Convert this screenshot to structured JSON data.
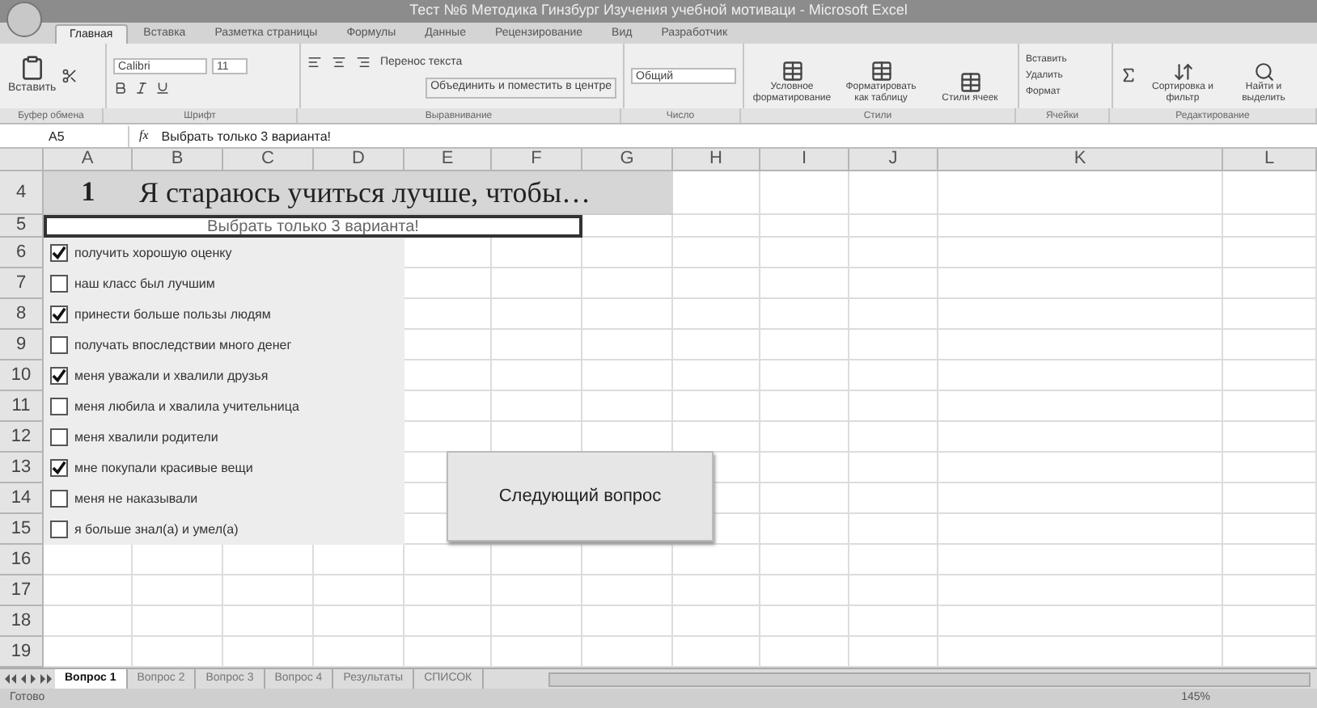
{
  "window": {
    "title": "Тест №6 Методика Гинзбург Изучения учебной мотиваци - Microsoft Excel"
  },
  "ribbon_tabs": [
    {
      "label": "Главная",
      "selected": true
    },
    {
      "label": "Вставка",
      "selected": false
    },
    {
      "label": "Разметка страницы",
      "selected": false
    },
    {
      "label": "Формулы",
      "selected": false
    },
    {
      "label": "Данные",
      "selected": false
    },
    {
      "label": "Рецензирование",
      "selected": false
    },
    {
      "label": "Вид",
      "selected": false
    },
    {
      "label": "Разработчик",
      "selected": false
    }
  ],
  "ribbon": {
    "paste": "Вставить",
    "font_name": "Calibri",
    "font_size": "11",
    "wrap_text": "Перенос текста",
    "merge": "Объединить и поместить в центре",
    "number_format": "Общий",
    "styles": [
      "Условное форматирование",
      "Форматировать как таблицу",
      "Стили ячеек"
    ],
    "cells": [
      "Вставить",
      "Удалить",
      "Формат"
    ],
    "editing": [
      "Сортировка и фильтр",
      "Найти и выделить"
    ]
  },
  "group_labels": [
    "Буфер обмена",
    "Шрифт",
    "Выравнивание",
    "Число",
    "Стили",
    "Ячейки",
    "Редактирование"
  ],
  "formula_bar": {
    "cell": "A5",
    "function_label": "fx",
    "formula": "Выбрать только 3 варианта!"
  },
  "columns": [
    "A",
    "B",
    "C",
    "D",
    "E",
    "F",
    "G",
    "H",
    "I",
    "J",
    "K",
    "L"
  ],
  "question": {
    "row": "4",
    "number": "1",
    "text": "Я стараюсь учиться лучше, чтобы…"
  },
  "instruction": {
    "row": "5",
    "text": "Выбрать только 3 варианта!"
  },
  "options": [
    {
      "row": "6",
      "label": "получить хорошую оценку",
      "checked": true
    },
    {
      "row": "7",
      "label": "наш класс был лучшим",
      "checked": false
    },
    {
      "row": "8",
      "label": "принести больше пользы людям",
      "checked": true
    },
    {
      "row": "9",
      "label": "получать впоследствии много денег",
      "checked": false
    },
    {
      "row": "10",
      "label": "меня уважали и хвалили друзья",
      "checked": true
    },
    {
      "row": "11",
      "label": "меня любила и хвалила учительница",
      "checked": false
    },
    {
      "row": "12",
      "label": "меня хвалили родители",
      "checked": false
    },
    {
      "row": "13",
      "label": "мне покупали красивые вещи",
      "checked": true
    },
    {
      "row": "14",
      "label": "меня не наказывали",
      "checked": false
    },
    {
      "row": "15",
      "label": "я больше знал(а) и умел(а)",
      "checked": false
    }
  ],
  "empty_rows": [
    "16",
    "17",
    "18",
    "19"
  ],
  "next_button": "Следующий вопрос",
  "sheet_tabs": [
    {
      "label": "Вопрос 1",
      "selected": true
    },
    {
      "label": "Вопрос 2",
      "selected": false
    },
    {
      "label": "Вопрос 3",
      "selected": false
    },
    {
      "label": "Вопрос 4",
      "selected": false
    },
    {
      "label": "Результаты",
      "selected": false
    },
    {
      "label": "СПИСОК",
      "selected": false
    }
  ],
  "status_bar": {
    "status": "Готово",
    "zoom": "145%"
  }
}
